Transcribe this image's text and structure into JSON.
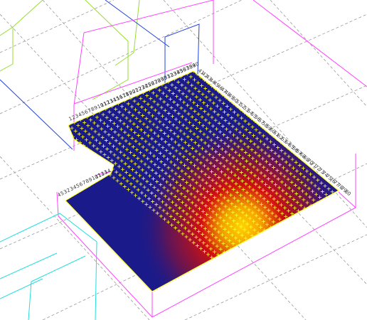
{
  "scene": {
    "view": "3D perspective viewport",
    "background_color": "#ffffff",
    "grid_color": "#9a9a9a",
    "mesh_fill": "#1a1a8a",
    "node_marker_color": "#ffff33",
    "node_label_color": "#3a3a3a",
    "heatmap_colors": [
      "#1a1a8a",
      "#8a1a3a",
      "#d01010",
      "#e85a00",
      "#ffd400"
    ],
    "wireframe_colors": {
      "room_box": "#ff44ff",
      "left_box": "#99dd33",
      "blue_plane": "#2244dd",
      "cyan_box": "#22dddd"
    },
    "node_labels_left": [
      "4",
      "5",
      "3",
      "2",
      "3",
      "4",
      "5",
      "6",
      "7",
      "8",
      "9",
      "10",
      "11",
      "12",
      "13",
      "14"
    ],
    "node_labels_back": [
      "1",
      "2",
      "3",
      "4",
      "5",
      "6",
      "7",
      "8",
      "9",
      "10",
      "11",
      "12",
      "13",
      "14",
      "15",
      "16",
      "17",
      "18",
      "19",
      "20",
      "21",
      "22",
      "23",
      "24",
      "25",
      "26",
      "27",
      "28",
      "29",
      "30",
      "31",
      "32",
      "33",
      "34",
      "35",
      "36",
      "37",
      "38",
      "39",
      "40"
    ],
    "node_labels_right": [
      "41",
      "42",
      "43",
      "44",
      "45",
      "46",
      "47",
      "48",
      "49",
      "50",
      "51",
      "52",
      "53",
      "54",
      "55",
      "56",
      "57",
      "58",
      "59",
      "60",
      "61",
      "62",
      "63",
      "64",
      "65",
      "66",
      "67",
      "68",
      "69",
      "70",
      "71",
      "72",
      "73",
      "74",
      "75",
      "76",
      "77",
      "78",
      "79",
      "80"
    ]
  }
}
